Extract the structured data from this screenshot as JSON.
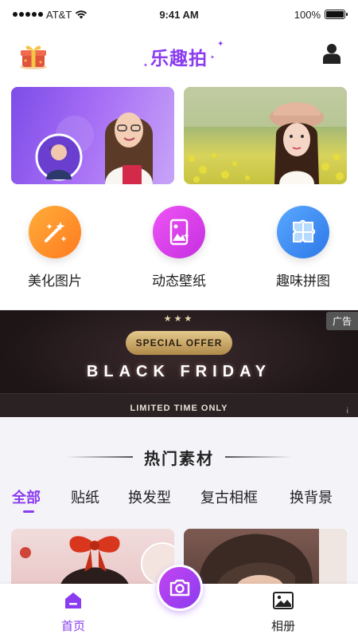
{
  "status_bar": {
    "carrier": "AT&T",
    "time": "9:41 AM",
    "battery": "100%",
    "battery_level": 1.0
  },
  "header": {
    "title": "乐趣拍",
    "left_icon": "gift-icon",
    "right_icon": "user-icon"
  },
  "banners": [
    {
      "name": "portrait-banner"
    },
    {
      "name": "flower-field-banner"
    }
  ],
  "features": [
    {
      "label": "美化图片",
      "icon": "magic-wand-icon",
      "color": "#ff8a2a"
    },
    {
      "label": "动态壁纸",
      "icon": "wallpaper-icon",
      "color": "#d63cf0"
    },
    {
      "label": "趣味拼图",
      "icon": "puzzle-icon",
      "color": "#3a8af0"
    }
  ],
  "ad": {
    "tag": "广告",
    "stars": "★★★",
    "offer": "SPECIAL OFFER",
    "headline": "BLACK FRIDAY",
    "subline": "LIMITED TIME ONLY",
    "info": "i"
  },
  "section": {
    "title": "热门素材"
  },
  "tabs": [
    {
      "label": "全部",
      "active": true
    },
    {
      "label": "贴纸",
      "active": false
    },
    {
      "label": "换发型",
      "active": false
    },
    {
      "label": "复古相框",
      "active": false
    },
    {
      "label": "换背景",
      "active": false
    }
  ],
  "tab_bar": {
    "home": "首页",
    "album": "相册",
    "camera_icon": "camera-icon"
  },
  "colors": {
    "accent": "#8a3cf0",
    "ad_background": "#1e1517"
  }
}
